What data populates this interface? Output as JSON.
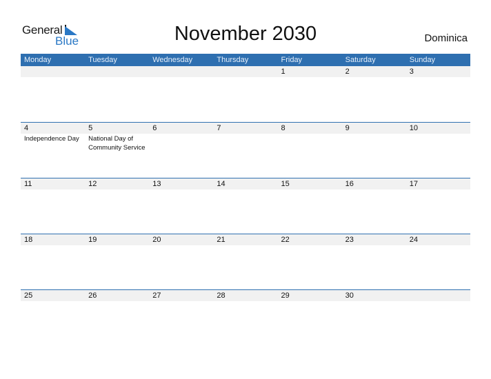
{
  "logo": {
    "general": "General",
    "blue": "Blue",
    "accent_color": "#2a78c5"
  },
  "title": "November 2030",
  "country": "Dominica",
  "header_color": "#2e6fb0",
  "weekdays": [
    "Monday",
    "Tuesday",
    "Wednesday",
    "Thursday",
    "Friday",
    "Saturday",
    "Sunday"
  ],
  "weeks": [
    {
      "days": [
        "",
        "",
        "",
        "",
        "1",
        "2",
        "3"
      ],
      "events": [
        "",
        "",
        "",
        "",
        "",
        "",
        ""
      ]
    },
    {
      "days": [
        "4",
        "5",
        "6",
        "7",
        "8",
        "9",
        "10"
      ],
      "events": [
        "Independence Day",
        "National Day of Community Service",
        "",
        "",
        "",
        "",
        ""
      ]
    },
    {
      "days": [
        "11",
        "12",
        "13",
        "14",
        "15",
        "16",
        "17"
      ],
      "events": [
        "",
        "",
        "",
        "",
        "",
        "",
        ""
      ]
    },
    {
      "days": [
        "18",
        "19",
        "20",
        "21",
        "22",
        "23",
        "24"
      ],
      "events": [
        "",
        "",
        "",
        "",
        "",
        "",
        ""
      ]
    },
    {
      "days": [
        "25",
        "26",
        "27",
        "28",
        "29",
        "30",
        ""
      ],
      "events": [
        "",
        "",
        "",
        "",
        "",
        "",
        ""
      ]
    }
  ]
}
